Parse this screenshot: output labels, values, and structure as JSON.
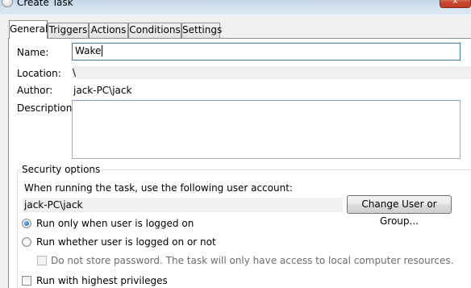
{
  "window": {
    "title": "Create Task",
    "close_glyph": "x",
    "title_icon": "task-clock-icon"
  },
  "tabs": [
    {
      "label": "General",
      "active": true
    },
    {
      "label": "Triggers",
      "active": false
    },
    {
      "label": "Actions",
      "active": false
    },
    {
      "label": "Conditions",
      "active": false
    },
    {
      "label": "Settings",
      "active": false
    }
  ],
  "general": {
    "name_label": "Name:",
    "name_value": "Wake",
    "location_label": "Location:",
    "location_value": "\\",
    "author_label": "Author:",
    "author_value": "jack-PC\\jack",
    "description_label": "Description:",
    "description_value": ""
  },
  "security": {
    "group_title": "Security options",
    "account_prompt": "When running the task, use the following user account:",
    "account_value": "jack-PC\\jack",
    "change_button": "Change User or Group...",
    "radio_logged_on": "Run only when user is logged on",
    "radio_logged_on_selected": true,
    "radio_whether": "Run whether user is logged on or not",
    "radio_whether_selected": false,
    "no_store_password": "Do not store password.  The task will only have access to local computer resources.",
    "no_store_password_checked": false,
    "highest_privileges": "Run with highest privileges",
    "highest_privileges_checked": false
  },
  "colors": {
    "selection_blue": "#1a5fb4",
    "focus_border": "#3d7bad"
  }
}
